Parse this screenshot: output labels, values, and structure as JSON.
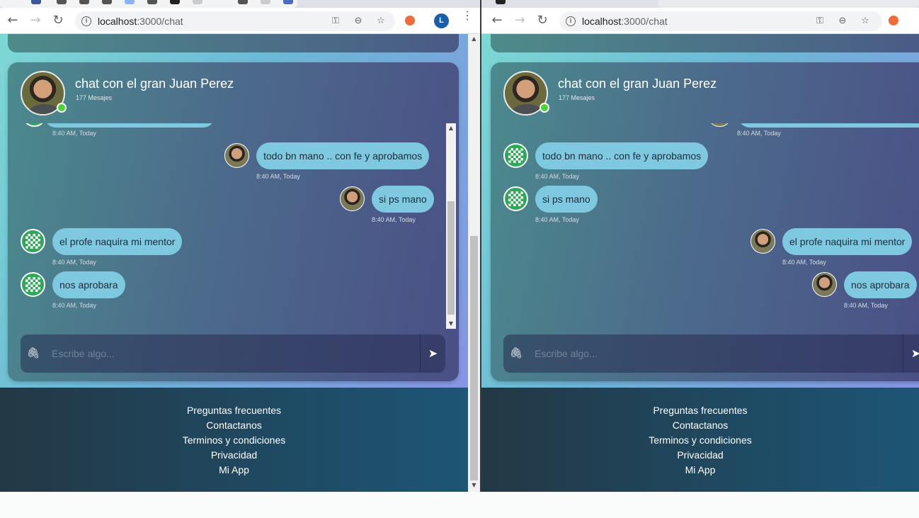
{
  "browser": {
    "url_host": "localhost",
    "url_path": ":3000/chat",
    "profile_initial": "L",
    "back_glyph": "←",
    "forward_glyph": "→",
    "reload_glyph": "↻",
    "key_glyph": "⚿",
    "zoom_glyph": "⊖",
    "star_glyph": "☆",
    "menu_glyph": "⋮"
  },
  "chat": {
    "title": "chat con el gran Juan Perez",
    "message_count": "177 Mesajes",
    "input_placeholder": "Escribe algo...",
    "attach_glyph": "🖇",
    "send_glyph": "➤"
  },
  "messages_left": [
    {
      "text": "",
      "time": "8:40 AM, Today",
      "side": "left",
      "avatar": "bot"
    },
    {
      "text": "todo bn mano .. con fe y aprobamos",
      "time": "8:40 AM, Today",
      "side": "right",
      "avatar": "user"
    },
    {
      "text": "si ps mano",
      "time": "8:40 AM, Today",
      "side": "right",
      "avatar": "user"
    },
    {
      "text": "el profe naquira mi mentor",
      "time": "8:40 AM, Today",
      "side": "left",
      "avatar": "bot"
    },
    {
      "text": "nos aprobara",
      "time": "8:40 AM, Today",
      "side": "left",
      "avatar": "bot"
    }
  ],
  "messages_right": [
    {
      "text": "",
      "time": "8:40 AM, Today",
      "side": "right",
      "avatar": "user"
    },
    {
      "text": "todo bn mano .. con fe y aprobamos",
      "time": "8:40 AM, Today",
      "side": "left",
      "avatar": "bot"
    },
    {
      "text": "si ps mano",
      "time": "8:40 AM, Today",
      "side": "left",
      "avatar": "bot"
    },
    {
      "text": "el profe naquira mi mentor",
      "time": "8:40 AM, Today",
      "side": "right",
      "avatar": "user"
    },
    {
      "text": "nos aprobara",
      "time": "8:40 AM, Today",
      "side": "right",
      "avatar": "user"
    }
  ],
  "footer": {
    "links": [
      "Preguntas frecuentes",
      "Contactanos",
      "Terminos y condiciones",
      "Privacidad",
      "Mi App"
    ]
  },
  "colors": {
    "bubble": "#7ec8e0",
    "online": "#4cd137",
    "footer": "#1f4a63"
  }
}
